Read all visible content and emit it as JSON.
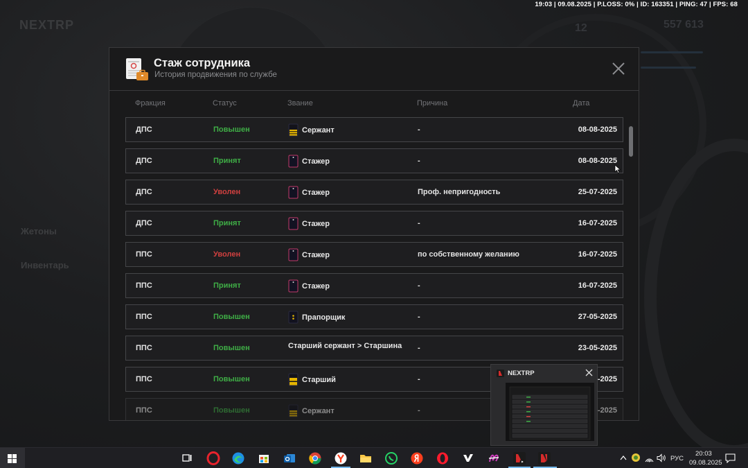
{
  "overlay": {
    "stats": "19:03 | 09.08.2025 | P.LOSS: 0% | ID: 163351 | PING: 47 | FPS: 68"
  },
  "background": {
    "logo": "NEXTRP",
    "labels": [
      "Жетоны",
      "Инвентарь"
    ],
    "numbers": [
      "12",
      "557 613"
    ]
  },
  "modal": {
    "title": "Стаж сотрудника",
    "subtitle": "История продвижения по службе",
    "columns": {
      "faction": "Фракция",
      "status": "Статус",
      "rank": "Звание",
      "reason": "Причина",
      "date": "Дата"
    },
    "rows": [
      {
        "faction": "ДПС",
        "status": "Повышен",
        "status_kind": "up",
        "rank": "Сержант",
        "rank_icon": "sergeant-shoulder-strap-icon",
        "reason": "-",
        "date": "08-08-2025"
      },
      {
        "faction": "ДПС",
        "status": "Принят",
        "status_kind": "hired",
        "rank": "Стажер",
        "rank_icon": "trainee-shoulder-strap-icon",
        "reason": "-",
        "date": "08-08-2025"
      },
      {
        "faction": "ДПС",
        "status": "Уволен",
        "status_kind": "fired",
        "rank": "Стажер",
        "rank_icon": "trainee-shoulder-strap-icon",
        "reason": "Проф. непригодность",
        "date": "25-07-2025"
      },
      {
        "faction": "ДПС",
        "status": "Принят",
        "status_kind": "hired",
        "rank": "Стажер",
        "rank_icon": "trainee-shoulder-strap-icon",
        "reason": "-",
        "date": "16-07-2025"
      },
      {
        "faction": "ППС",
        "status": "Уволен",
        "status_kind": "fired",
        "rank": "Стажер",
        "rank_icon": "trainee-shoulder-strap-icon",
        "reason": "по собственному желанию",
        "date": "16-07-2025"
      },
      {
        "faction": "ППС",
        "status": "Принят",
        "status_kind": "hired",
        "rank": "Стажер",
        "rank_icon": "trainee-shoulder-strap-icon",
        "reason": "-",
        "date": "16-07-2025"
      },
      {
        "faction": "ППС",
        "status": "Повышен",
        "status_kind": "up",
        "rank": "Прапорщик",
        "rank_icon": "ensign-shoulder-strap-icon",
        "reason": "-",
        "date": "27-05-2025"
      },
      {
        "faction": "ППС",
        "status": "Повышен",
        "status_kind": "up",
        "rank": "Старший сержант > Старшина",
        "rank_icon": "",
        "reason": "-",
        "date": "23-05-2025"
      },
      {
        "faction": "ППС",
        "status": "Повышен",
        "status_kind": "up",
        "rank": "Старший",
        "rank_icon": "senior-sergeant-shoulder-strap-icon",
        "reason": "-",
        "date": "21-05-2025"
      },
      {
        "faction": "ППС",
        "status": "Повышен",
        "status_kind": "up",
        "rank": "Сержант",
        "rank_icon": "sergeant-shoulder-strap-icon",
        "reason": "-",
        "date": "20-05-2025"
      }
    ]
  },
  "preview": {
    "title": "NEXTRP"
  },
  "taskbar": {
    "language": "РУС",
    "time": "20:03",
    "date": "09.08.2025"
  },
  "colors": {
    "status_up": "#3fae46",
    "status_fired": "#d0403f",
    "accent": "#76b9ed"
  }
}
